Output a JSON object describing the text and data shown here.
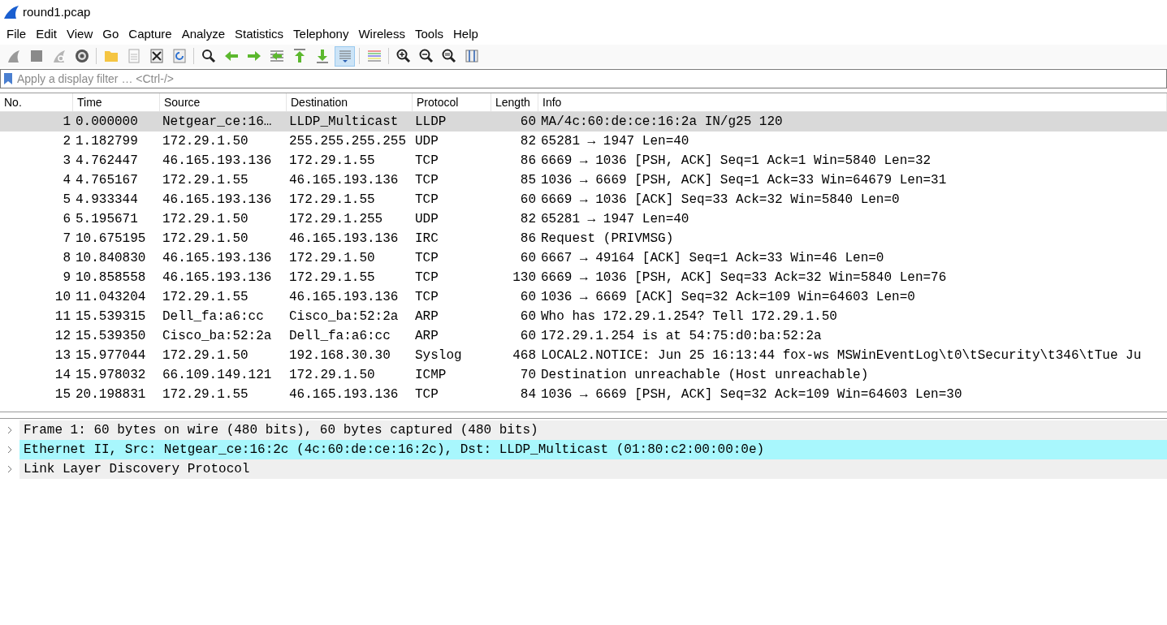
{
  "window": {
    "title": "round1.pcap"
  },
  "menu": [
    "File",
    "Edit",
    "View",
    "Go",
    "Capture",
    "Analyze",
    "Statistics",
    "Telephony",
    "Wireless",
    "Tools",
    "Help"
  ],
  "toolbar": [
    {
      "kind": "fin",
      "pressed": false
    },
    {
      "kind": "stop",
      "pressed": false
    },
    {
      "kind": "restart",
      "pressed": false
    },
    {
      "kind": "gear",
      "pressed": false
    },
    {
      "kind": "sep"
    },
    {
      "kind": "folder",
      "pressed": false
    },
    {
      "kind": "file",
      "pressed": false
    },
    {
      "kind": "close",
      "pressed": false
    },
    {
      "kind": "reload",
      "pressed": false
    },
    {
      "kind": "sep"
    },
    {
      "kind": "search",
      "pressed": false
    },
    {
      "kind": "left",
      "pressed": false
    },
    {
      "kind": "right",
      "pressed": false
    },
    {
      "kind": "goto",
      "pressed": false
    },
    {
      "kind": "top",
      "pressed": false
    },
    {
      "kind": "bottom",
      "pressed": false
    },
    {
      "kind": "autoscroll",
      "pressed": true
    },
    {
      "kind": "sep"
    },
    {
      "kind": "colorize",
      "pressed": false
    },
    {
      "kind": "sep"
    },
    {
      "kind": "zoomin",
      "pressed": false
    },
    {
      "kind": "zoomout",
      "pressed": false
    },
    {
      "kind": "zoomreset",
      "pressed": false
    },
    {
      "kind": "resize",
      "pressed": false
    }
  ],
  "filter": {
    "placeholder": "Apply a display filter … <Ctrl-/>"
  },
  "packet_list": {
    "columns": [
      "No.",
      "Time",
      "Source",
      "Destination",
      "Protocol",
      "Length",
      "Info"
    ],
    "rows": [
      {
        "selected": true,
        "cells": [
          "1",
          "0.000000",
          "Netgear_ce:16…",
          "LLDP_Multicast",
          "LLDP",
          "60",
          "MA/4c:60:de:ce:16:2a IN/g25 120"
        ]
      },
      {
        "selected": false,
        "cells": [
          "2",
          "1.182799",
          "172.29.1.50",
          "255.255.255.255",
          "UDP",
          "82",
          "65281 → 1947 Len=40"
        ]
      },
      {
        "selected": false,
        "cells": [
          "3",
          "4.762447",
          "46.165.193.136",
          "172.29.1.55",
          "TCP",
          "86",
          "6669 → 1036 [PSH, ACK] Seq=1 Ack=1 Win=5840 Len=32"
        ]
      },
      {
        "selected": false,
        "cells": [
          "4",
          "4.765167",
          "172.29.1.55",
          "46.165.193.136",
          "TCP",
          "85",
          "1036 → 6669 [PSH, ACK] Seq=1 Ack=33 Win=64679 Len=31"
        ]
      },
      {
        "selected": false,
        "cells": [
          "5",
          "4.933344",
          "46.165.193.136",
          "172.29.1.55",
          "TCP",
          "60",
          "6669 → 1036 [ACK] Seq=33 Ack=32 Win=5840 Len=0"
        ]
      },
      {
        "selected": false,
        "cells": [
          "6",
          "5.195671",
          "172.29.1.50",
          "172.29.1.255",
          "UDP",
          "82",
          "65281 → 1947 Len=40"
        ]
      },
      {
        "selected": false,
        "cells": [
          "7",
          "10.675195",
          "172.29.1.50",
          "46.165.193.136",
          "IRC",
          "86",
          "Request (PRIVMSG)"
        ]
      },
      {
        "selected": false,
        "cells": [
          "8",
          "10.840830",
          "46.165.193.136",
          "172.29.1.50",
          "TCP",
          "60",
          "6667 → 49164 [ACK] Seq=1 Ack=33 Win=46 Len=0"
        ]
      },
      {
        "selected": false,
        "cells": [
          "9",
          "10.858558",
          "46.165.193.136",
          "172.29.1.55",
          "TCP",
          "130",
          "6669 → 1036 [PSH, ACK] Seq=33 Ack=32 Win=5840 Len=76"
        ]
      },
      {
        "selected": false,
        "cells": [
          "10",
          "11.043204",
          "172.29.1.55",
          "46.165.193.136",
          "TCP",
          "60",
          "1036 → 6669 [ACK] Seq=32 Ack=109 Win=64603 Len=0"
        ]
      },
      {
        "selected": false,
        "cells": [
          "11",
          "15.539315",
          "Dell_fa:a6:cc",
          "Cisco_ba:52:2a",
          "ARP",
          "60",
          "Who has 172.29.1.254? Tell 172.29.1.50"
        ]
      },
      {
        "selected": false,
        "cells": [
          "12",
          "15.539350",
          "Cisco_ba:52:2a",
          "Dell_fa:a6:cc",
          "ARP",
          "60",
          "172.29.1.254 is at 54:75:d0:ba:52:2a"
        ]
      },
      {
        "selected": false,
        "cells": [
          "13",
          "15.977044",
          "172.29.1.50",
          "192.168.30.30",
          "Syslog",
          "468",
          "LOCAL2.NOTICE: Jun 25 16:13:44 fox-ws MSWinEventLog\\t0\\tSecurity\\t346\\tTue Ju"
        ]
      },
      {
        "selected": false,
        "cells": [
          "14",
          "15.978032",
          "66.109.149.121",
          "172.29.1.50",
          "ICMP",
          "70",
          "Destination unreachable (Host unreachable)"
        ]
      },
      {
        "selected": false,
        "cells": [
          "15",
          "20.198831",
          "172.29.1.55",
          "46.165.193.136",
          "TCP",
          "84",
          "1036 → 6669 [PSH, ACK] Seq=32 Ack=109 Win=64603 Len=30"
        ]
      }
    ]
  },
  "packet_details": [
    {
      "label": "Frame 1: 60 bytes on wire (480 bits), 60 bytes captured (480 bits)",
      "expanded": false,
      "selected": false
    },
    {
      "label": "Ethernet II, Src: Netgear_ce:16:2c (4c:60:de:ce:16:2c), Dst: LLDP_Multicast (01:80:c2:00:00:0e)",
      "expanded": false,
      "selected": true
    },
    {
      "label": "Link Layer Discovery Protocol",
      "expanded": false,
      "selected": false
    }
  ]
}
